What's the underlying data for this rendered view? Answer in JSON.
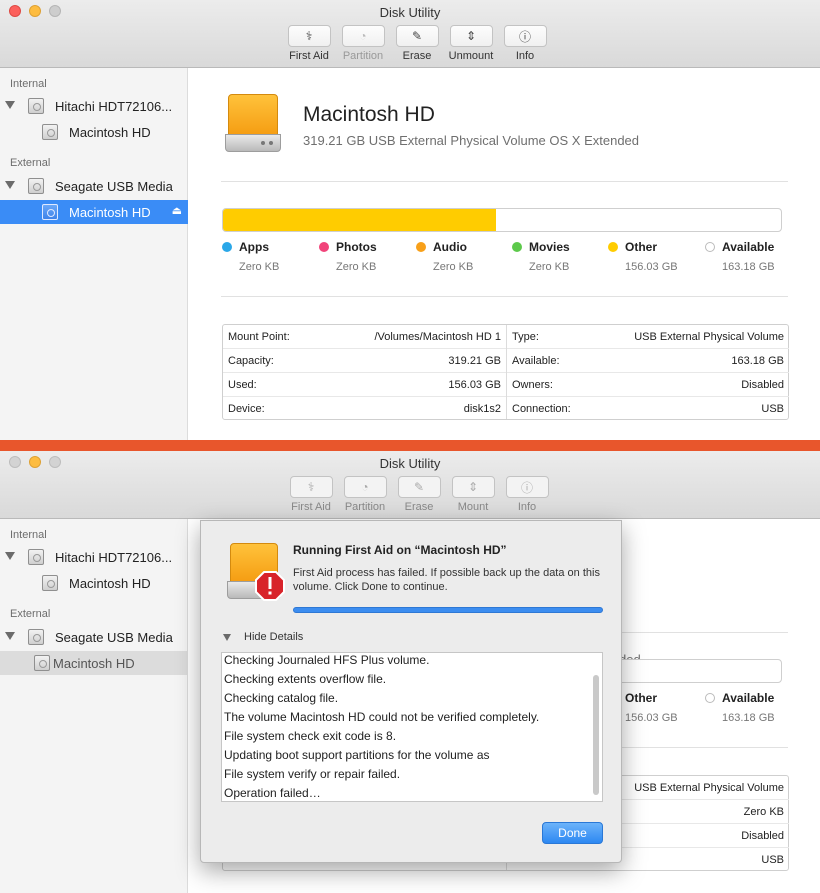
{
  "app": {
    "title": "Disk Utility"
  },
  "toolbar": [
    {
      "label": "First Aid",
      "icon": "first-aid-icon",
      "glyph": "⚕"
    },
    {
      "label": "Partition",
      "icon": "partition-icon",
      "glyph": "◔"
    },
    {
      "label": "Erase",
      "icon": "erase-icon",
      "glyph": "✎"
    },
    {
      "label": "Unmount",
      "icon": "unmount-icon",
      "glyph": "⇕"
    },
    {
      "label": "Info",
      "icon": "info-icon",
      "glyph": "ⓘ"
    }
  ],
  "toolbar2": [
    {
      "label": "First Aid",
      "icon": "first-aid-icon",
      "glyph": "⚕"
    },
    {
      "label": "Partition",
      "icon": "partition-icon",
      "glyph": "◔"
    },
    {
      "label": "Erase",
      "icon": "erase-icon",
      "glyph": "✎"
    },
    {
      "label": "Mount",
      "icon": "mount-icon",
      "glyph": "⇕"
    },
    {
      "label": "Info",
      "icon": "info-icon",
      "glyph": "ⓘ"
    }
  ],
  "sidebar": {
    "internal_header": "Internal",
    "external_header": "External",
    "internal_disk": "Hitachi HDT72106...",
    "internal_volume": "Macintosh HD",
    "external_disk": "Seagate USB Media",
    "external_volume": "Macintosh HD"
  },
  "volume": {
    "name": "Macintosh HD",
    "subtitle": "319.21 GB USB External Physical Volume OS X Extended"
  },
  "usage": {
    "used_fraction": 0.49,
    "legend": [
      {
        "name": "Apps",
        "value": "Zero KB",
        "color": "#2aa7e8"
      },
      {
        "name": "Photos",
        "value": "Zero KB",
        "color": "#f1437a"
      },
      {
        "name": "Audio",
        "value": "Zero KB",
        "color": "#f8a019"
      },
      {
        "name": "Movies",
        "value": "Zero KB",
        "color": "#5dc94b"
      },
      {
        "name": "Other",
        "value": "156.03 GB",
        "color": "#ffcc00"
      },
      {
        "name": "Available",
        "value": "163.18 GB",
        "color": "#ffffff"
      }
    ]
  },
  "info": {
    "left": [
      {
        "k": "Mount Point:",
        "v": "/Volumes/Macintosh HD 1"
      },
      {
        "k": "Capacity:",
        "v": "319.21 GB"
      },
      {
        "k": "Used:",
        "v": "156.03 GB"
      },
      {
        "k": "Device:",
        "v": "disk1s2"
      }
    ],
    "right": [
      {
        "k": "Type:",
        "v": "USB External Physical Volume"
      },
      {
        "k": "Available:",
        "v": "163.18 GB"
      },
      {
        "k": "Owners:",
        "v": "Disabled"
      },
      {
        "k": "Connection:",
        "v": "USB"
      }
    ]
  },
  "win2_visible": {
    "subtitle_tail": "ded",
    "other_value": "156.03 GB",
    "available_value": "163.18 GB",
    "type_value": "USB External Physical Volume",
    "available_info": "Zero KB",
    "owners_value": "Disabled",
    "connection_value": "USB",
    "device_tail": "disk1s2",
    "device_label": "Device:",
    "connection_label": "Connection:"
  },
  "dialog": {
    "title": "Running First Aid on “Macintosh HD”",
    "message": "First Aid process has failed. If possible back up the data on this volume. Click Done to continue.",
    "hide_details": "Hide Details",
    "log": [
      "Checking Journaled HFS Plus volume.",
      "Checking extents overflow file.",
      "Checking catalog file.",
      "The volume Macintosh HD could not be verified completely.",
      "File system check exit code is 8.",
      "Updating boot support partitions for the volume as",
      "File system verify or repair failed.",
      "Operation failed…"
    ],
    "done_label": "Done"
  },
  "colors": {
    "accent": "#3a8cf6",
    "divider": "#e8562c",
    "warning": "#d8232a"
  }
}
